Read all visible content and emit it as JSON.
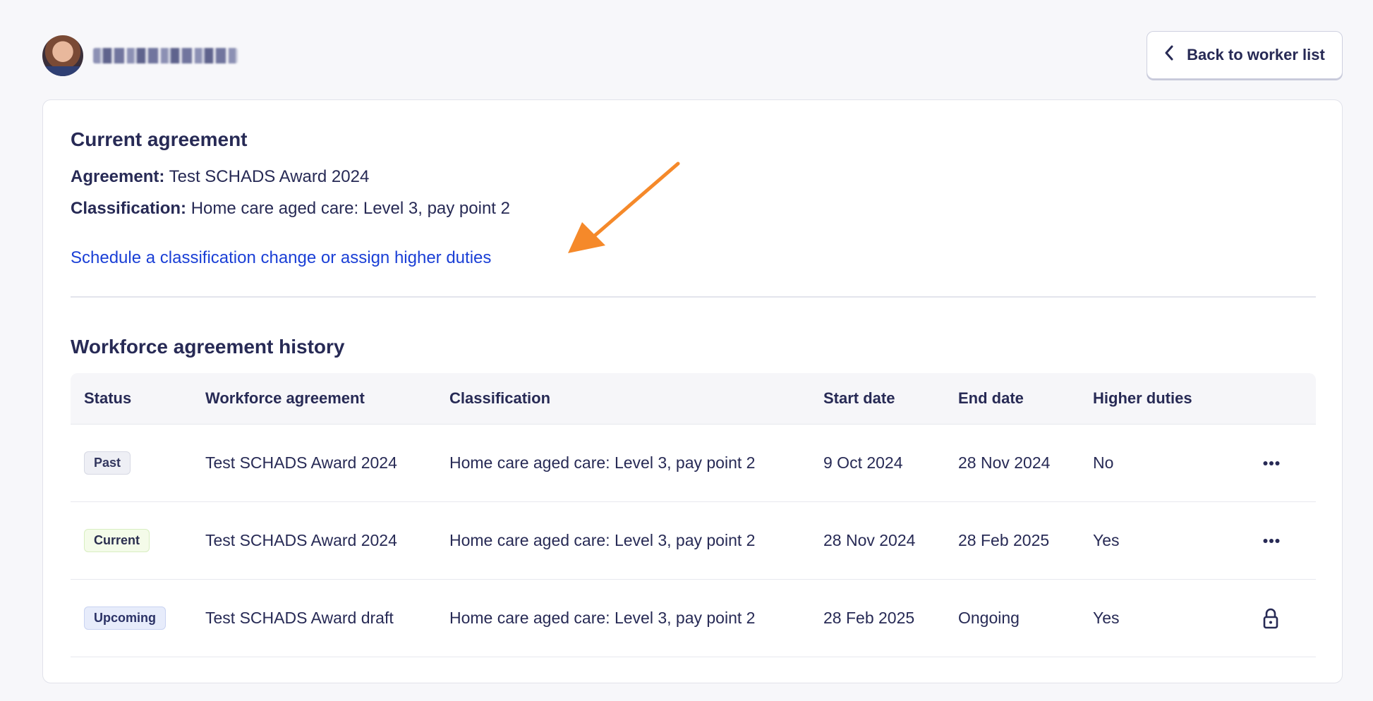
{
  "header": {
    "worker_name": "",
    "back_label": "Back to worker list"
  },
  "current_agreement": {
    "title": "Current agreement",
    "agreement_label": "Agreement:",
    "agreement_value": "Test SCHADS Award 2024",
    "classification_label": "Classification:",
    "classification_value": "Home care aged care: Level 3, pay point 2",
    "schedule_link": "Schedule a classification change or assign higher duties"
  },
  "history": {
    "title": "Workforce agreement history",
    "columns": [
      "Status",
      "Workforce agreement",
      "Classification",
      "Start date",
      "End date",
      "Higher duties"
    ],
    "rows": [
      {
        "status": "Past",
        "agreement": "Test SCHADS Award 2024",
        "classification": "Home care aged care: Level 3, pay point 2",
        "start": "9 Oct 2024",
        "end": "28 Nov 2024",
        "higher_duties": "No",
        "action_icon": "more-icon"
      },
      {
        "status": "Current",
        "agreement": "Test SCHADS Award 2024",
        "classification": "Home care aged care: Level 3, pay point 2",
        "start": "28 Nov 2024",
        "end": "28 Feb 2025",
        "higher_duties": "Yes",
        "action_icon": "more-icon"
      },
      {
        "status": "Upcoming",
        "agreement": "Test SCHADS Award draft",
        "classification": "Home care aged care: Level 3, pay point 2",
        "start": "28 Feb 2025",
        "end": "Ongoing",
        "higher_duties": "Yes",
        "action_icon": "lock-icon"
      }
    ]
  },
  "colors": {
    "text": "#272a55",
    "link": "#1a3fd6",
    "annotation_arrow": "#f5892a",
    "background": "#f7f7fa"
  }
}
